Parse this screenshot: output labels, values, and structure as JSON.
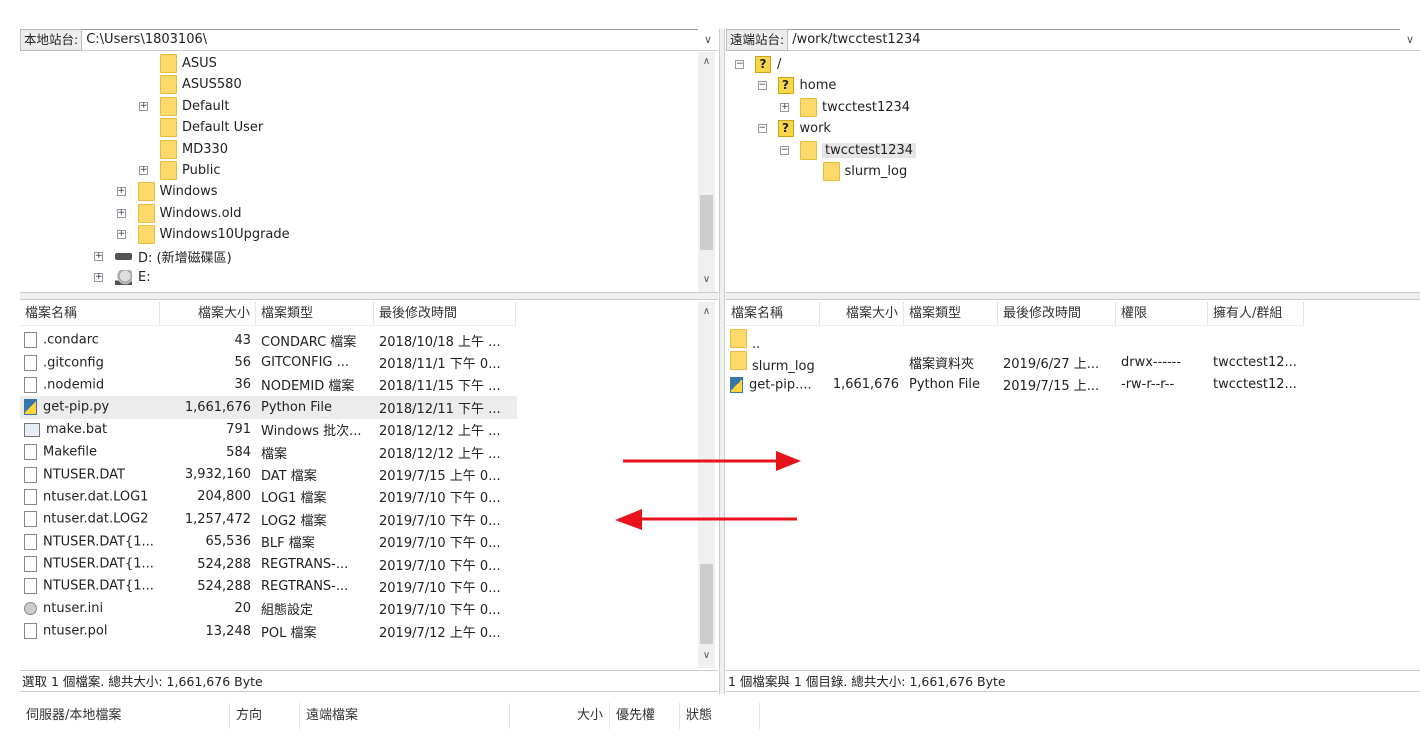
{
  "local": {
    "site_label": "本地站台:",
    "path": "C:\\Users\\1803106\\",
    "tree": [
      {
        "label": "ASUS",
        "icon": "folder",
        "level": 2,
        "exp": false
      },
      {
        "label": "ASUS580",
        "icon": "folder",
        "level": 2,
        "exp": false
      },
      {
        "label": "Default",
        "icon": "folder",
        "level": 2,
        "exp": true
      },
      {
        "label": "Default User",
        "icon": "folder",
        "level": 2,
        "exp": false
      },
      {
        "label": "MD330",
        "icon": "folder",
        "level": 2,
        "exp": false
      },
      {
        "label": "Public",
        "icon": "folder",
        "level": 2,
        "exp": true
      },
      {
        "label": "Windows",
        "icon": "folder",
        "level": 1,
        "exp": true
      },
      {
        "label": "Windows.old",
        "icon": "folder",
        "level": 1,
        "exp": true
      },
      {
        "label": "Windows10Upgrade",
        "icon": "folder",
        "level": 1,
        "exp": true
      },
      {
        "label": "D: (新增磁碟區)",
        "icon": "drive",
        "level": 0,
        "exp": true
      },
      {
        "label": "E:",
        "icon": "cd-drive",
        "level": 0,
        "exp": true
      }
    ],
    "columns": [
      "檔案名稱",
      "檔案大小",
      "檔案類型",
      "最後修改時間"
    ],
    "files": [
      {
        "name": ".condarc",
        "size": "43",
        "type": "CONDARC 檔案",
        "modified": "2018/10/18 上午 ...",
        "icon": "file"
      },
      {
        "name": ".gitconfig",
        "size": "56",
        "type": "GITCONFIG ...",
        "modified": "2018/11/1 下午 0...",
        "icon": "file"
      },
      {
        "name": ".nodemid",
        "size": "36",
        "type": "NODEMID 檔案",
        "modified": "2018/11/15 下午 ...",
        "icon": "file"
      },
      {
        "name": "get-pip.py",
        "size": "1,661,676",
        "type": "Python File",
        "modified": "2018/12/11 下午 ...",
        "icon": "python",
        "selected": true
      },
      {
        "name": "make.bat",
        "size": "791",
        "type": "Windows 批次...",
        "modified": "2018/12/12 上午 ...",
        "icon": "batch"
      },
      {
        "name": "Makefile",
        "size": "584",
        "type": "檔案",
        "modified": "2018/12/12 上午 ...",
        "icon": "file"
      },
      {
        "name": "NTUSER.DAT",
        "size": "3,932,160",
        "type": "DAT 檔案",
        "modified": "2019/7/15 上午 0...",
        "icon": "file"
      },
      {
        "name": "ntuser.dat.LOG1",
        "size": "204,800",
        "type": "LOG1 檔案",
        "modified": "2019/7/10 下午 0...",
        "icon": "file"
      },
      {
        "name": "ntuser.dat.LOG2",
        "size": "1,257,472",
        "type": "LOG2 檔案",
        "modified": "2019/7/10 下午 0...",
        "icon": "file"
      },
      {
        "name": "NTUSER.DAT{1...",
        "size": "65,536",
        "type": "BLF 檔案",
        "modified": "2019/7/10 下午 0...",
        "icon": "file"
      },
      {
        "name": "NTUSER.DAT{1...",
        "size": "524,288",
        "type": "REGTRANS-...",
        "modified": "2019/7/10 下午 0...",
        "icon": "file"
      },
      {
        "name": "NTUSER.DAT{1...",
        "size": "524,288",
        "type": "REGTRANS-...",
        "modified": "2019/7/10 下午 0...",
        "icon": "file"
      },
      {
        "name": "ntuser.ini",
        "size": "20",
        "type": "組態設定",
        "modified": "2019/7/10 下午 0...",
        "icon": "settings"
      },
      {
        "name": "ntuser.pol",
        "size": "13,248",
        "type": "POL 檔案",
        "modified": "2019/7/12 上午 0...",
        "icon": "file"
      }
    ],
    "status": "選取 1 個檔案. 總共大小: 1,661,676 Byte"
  },
  "remote": {
    "site_label": "遠端站台:",
    "path": "/work/twcctest1234",
    "tree": [
      {
        "label": "/",
        "icon": "unknown",
        "level": 0,
        "exp": "-"
      },
      {
        "label": "home",
        "icon": "unknown",
        "level": 1,
        "exp": "-"
      },
      {
        "label": "twcctest1234",
        "icon": "folder",
        "level": 2,
        "exp": "+"
      },
      {
        "label": "work",
        "icon": "unknown",
        "level": 1,
        "exp": "-"
      },
      {
        "label": "twcctest1234",
        "icon": "folder",
        "level": 2,
        "exp": "-",
        "selected": true
      },
      {
        "label": "slurm_log",
        "icon": "folder",
        "level": 3,
        "exp": ""
      }
    ],
    "columns": [
      "檔案名稱",
      "檔案大小",
      "檔案類型",
      "最後修改時間",
      "權限",
      "擁有人/群組"
    ],
    "files": [
      {
        "name": "..",
        "size": "",
        "type": "",
        "modified": "",
        "perm": "",
        "owner": "",
        "icon": "folder"
      },
      {
        "name": "slurm_log",
        "size": "",
        "type": "檔案資料夾",
        "modified": "2019/6/27 上...",
        "perm": "drwx------",
        "owner": "twcctest12...",
        "icon": "folder"
      },
      {
        "name": "get-pip....",
        "size": "1,661,676",
        "type": "Python File",
        "modified": "2019/7/15 上...",
        "perm": "-rw-r--r--",
        "owner": "twcctest12...",
        "icon": "python"
      }
    ],
    "status": "1 個檔案與 1 個目錄. 總共大小: 1,661,676 Byte"
  },
  "queue": {
    "columns": [
      "伺服器/本地檔案",
      "方向",
      "遠端檔案",
      "大小",
      "優先權",
      "狀態"
    ]
  },
  "colors": {
    "arrow": "#e8121b",
    "folder": "#fbd96a"
  }
}
